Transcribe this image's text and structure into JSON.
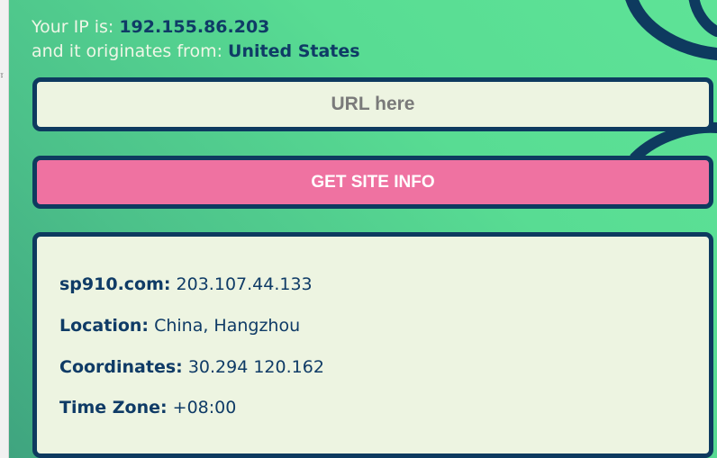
{
  "ip_info": {
    "ip_label": "Your IP is:",
    "ip_value": "192.155.86.203",
    "origin_label": "and it originates from:",
    "origin_value": "United States"
  },
  "url_input": {
    "placeholder": "URL here",
    "value": ""
  },
  "get_button": {
    "label": "GET SITE INFO"
  },
  "site_info": {
    "domain_label": "sp910.com:",
    "domain_value": "203.107.44.133",
    "location_label": "Location:",
    "location_value": "China, Hangzhou",
    "coordinates_label": "Coordinates:",
    "coordinates_value": "30.294 120.162",
    "timezone_label": "Time Zone:",
    "timezone_value": "+08:00"
  },
  "colors": {
    "background_green": "#58dc93",
    "navy": "#0e3a5f",
    "pink_button": "#ef72a1",
    "card_bg": "#edf4e1"
  }
}
